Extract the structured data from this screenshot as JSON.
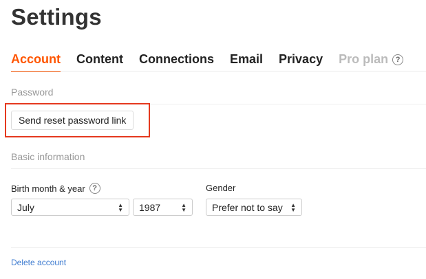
{
  "page": {
    "title": "Settings"
  },
  "tabs": [
    {
      "label": "Account",
      "active": true
    },
    {
      "label": "Content"
    },
    {
      "label": "Connections"
    },
    {
      "label": "Email"
    },
    {
      "label": "Privacy"
    },
    {
      "label": "Pro plan",
      "disabled": true,
      "help_icon": "?"
    }
  ],
  "password": {
    "heading": "Password",
    "reset_button_label": "Send reset password link"
  },
  "basic_info": {
    "heading": "Basic information",
    "birth_label": "Birth month & year",
    "birth_help": "?",
    "month_value": "July",
    "year_value": "1987",
    "gender_label": "Gender",
    "gender_value": "Prefer not to say"
  },
  "footer": {
    "delete_account_label": "Delete account"
  },
  "colors": {
    "accent": "#ff5500",
    "highlight": "#e5391e",
    "link": "#3d7bd0"
  }
}
